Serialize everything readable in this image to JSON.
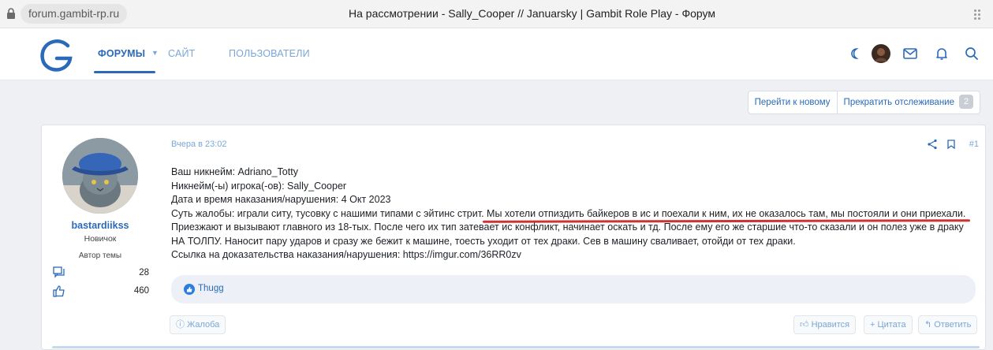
{
  "browser": {
    "url": "forum.gambit-rp.ru",
    "window_title": "На рассмотрении - Sally_Cooper // Januarsky | Gambit Role Play - Форум"
  },
  "header": {
    "nav": [
      {
        "label": "Форумы"
      },
      {
        "label": "Сайт"
      },
      {
        "label": "Пользователи"
      }
    ],
    "icons": [
      "moon-icon",
      "avatar",
      "mail-icon",
      "bell-icon",
      "search-icon"
    ]
  },
  "actions": {
    "goto_new": "Перейти к новому",
    "unwatch": "Прекратить отслеживание",
    "unwatch_count": "2"
  },
  "post": {
    "user": {
      "name": "bastardiikss",
      "title": "Новичок",
      "author_label": "Автор темы",
      "messages": "28",
      "reactions": "460"
    },
    "date": "Вчера в 23:02",
    "number": "#1",
    "lines": [
      "Ваш никнейм: Adriano_Totty",
      "Никнейм(-ы) игрока(-ов): Sally_Cooper",
      "Дата и время наказания/нарушения: 4 Окт 2023",
      "Суть жалобы: играли ситу, тусовку с нашими типами с эйтинс стрит. Мы хотели отпиздить байкеров в ис и поехали к ним, их не оказалось там, мы постояли и они приехали.",
      "Приезжают и вызывают главного из 18-тых. После чего их тип затевает ис конфликт, начинает оскать и тд. После ему его же старшие что-то сказали и он полез уже в драку",
      "НА ТОЛПУ. Наносит пару ударов и сразу же бежит к машине, тоесть уходит от тех драки. Сев в машину сваливает, отойди от тех драки.",
      "Ссылка на доказательства наказания/нарушения: https://imgur.com/36RR0zv"
    ],
    "reaction_user": "Thugg",
    "report": "Жалоба",
    "like": "Нравится",
    "quote": "+ Цитата",
    "reply": "Ответить"
  },
  "colors": {
    "accent": "#2a6ab8",
    "link_light": "#7aa7d6",
    "underline_red": "#cc3333"
  }
}
